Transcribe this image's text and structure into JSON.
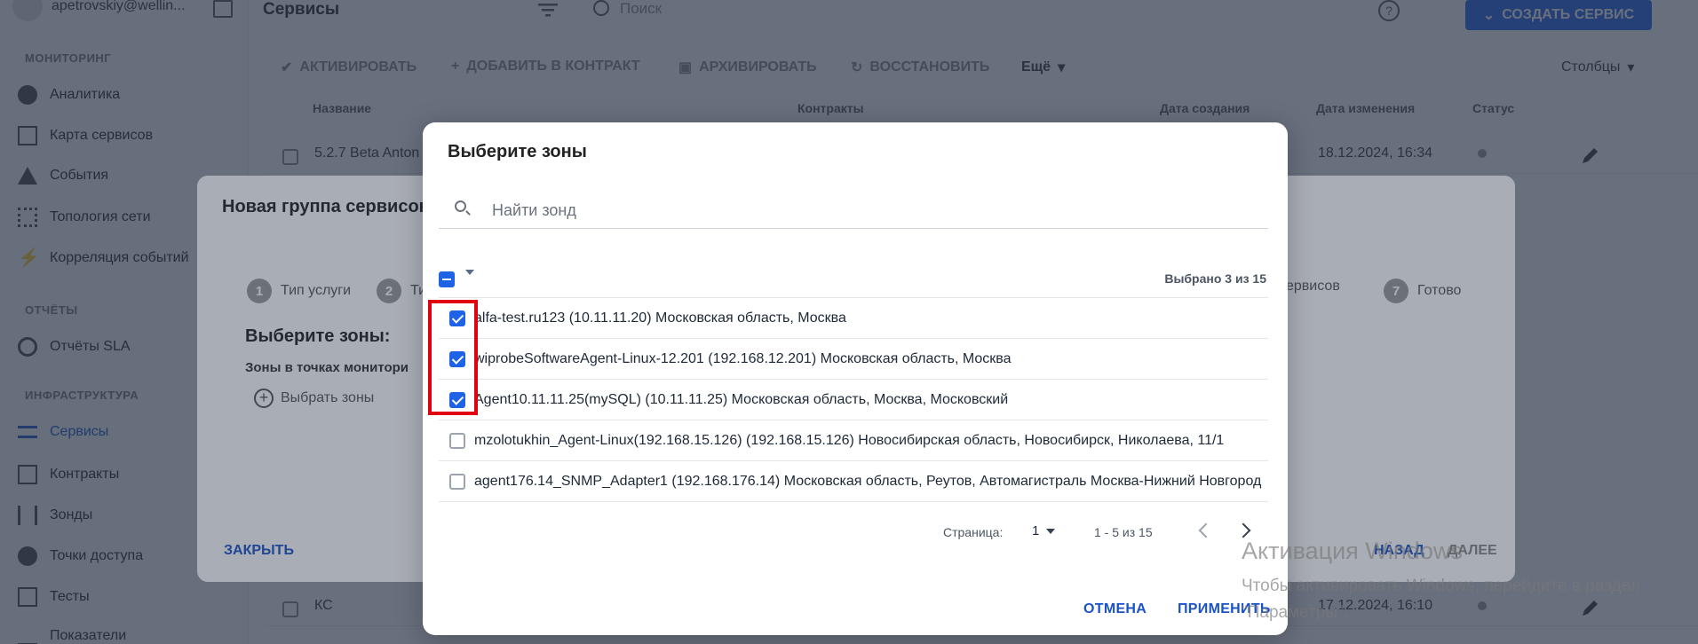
{
  "user": {
    "email": "apetrovskiy@wellin..."
  },
  "sidebar": {
    "sections": [
      {
        "title": "МОНИТОРИНГ",
        "items": [
          "Аналитика",
          "Карта сервисов",
          "События",
          "Топология сети",
          "Корреляция событий"
        ]
      },
      {
        "title": "ОТЧЁТЫ",
        "items": [
          "Отчёты SLA"
        ]
      },
      {
        "title": "ИНФРАСТРУКТУРА",
        "items": [
          "Сервисы",
          "Контракты",
          "Зонды",
          "Точки доступа",
          "Тесты",
          "Показатели"
        ]
      }
    ],
    "active_item": "Сервисы"
  },
  "header": {
    "title": "Сервисы",
    "search_placeholder": "Поиск",
    "help": "?",
    "create_button": "СОЗДАТЬ СЕРВИС"
  },
  "toolbar": {
    "activate": "АКТИВИРОВАТЬ",
    "add_to_contract": "ДОБАВИТЬ В КОНТРАКТ",
    "archive": "АРХИВИРОВАТЬ",
    "restore": "ВОССТАНОВИТЬ",
    "more": "Ещё",
    "columns": "Столбцы"
  },
  "table": {
    "headers": {
      "name": "Название",
      "contracts": "Контракты",
      "created": "Дата создания",
      "modified": "Дата изменения",
      "status": "Статус"
    },
    "rows": [
      {
        "name": "5.2.7 Beta Anton",
        "modified": "18.12.2024, 16:34"
      },
      {
        "name": "КС",
        "modified": "17.12.2024, 16:10"
      }
    ]
  },
  "group_dialog": {
    "title": "Новая группа сервисов",
    "steps": [
      {
        "num": "1",
        "label": "Тип услуги"
      },
      {
        "num": "2",
        "label": "Ти"
      },
      {
        "num": "",
        "label": "сервисов"
      },
      {
        "num": "7",
        "label": "Готово"
      }
    ],
    "subtitle": "Выберите зоны:",
    "subtitle2": "Зоны в точках монитори",
    "choose_zones": "Выбрать зоны",
    "close": "ЗАКРЫТЬ",
    "back": "НАЗАД",
    "next": "ДАЛЕЕ"
  },
  "zone_dialog": {
    "title": "Выберите зоны",
    "search_placeholder": "Найти зонд",
    "selected_count": "Выбрано 3 из 15",
    "zones": [
      {
        "label": "alfa-test.ru123 (10.11.11.20) Московская область, Москва",
        "checked": true
      },
      {
        "label": "wiprobeSoftwareAgent-Linux-12.201 (192.168.12.201) Московская область, Москва",
        "checked": true
      },
      {
        "label": "Agent10.11.11.25(mySQL) (10.11.11.25) Московская область, Москва, Московский",
        "checked": true
      },
      {
        "label": "mzolotukhin_Agent-Linux(192.168.15.126) (192.168.15.126) Новосибирская область, Новосибирск, Николаева, 11/1",
        "checked": false
      },
      {
        "label": "agent176.14_SNMP_Adapter1 (192.168.176.14) Московская область, Реутов, Автомагистраль Москва-Нижний Новгород",
        "checked": false
      }
    ],
    "pagination": {
      "label": "Страница:",
      "page": "1",
      "range": "1 - 5 из 15"
    },
    "cancel": "ОТМЕНА",
    "apply": "ПРИМЕНИТЬ"
  },
  "watermark": {
    "title": "Активация Windows",
    "subtitle": "Чтобы активировать Windows, перейдите в раздел \"Параметры\"."
  }
}
